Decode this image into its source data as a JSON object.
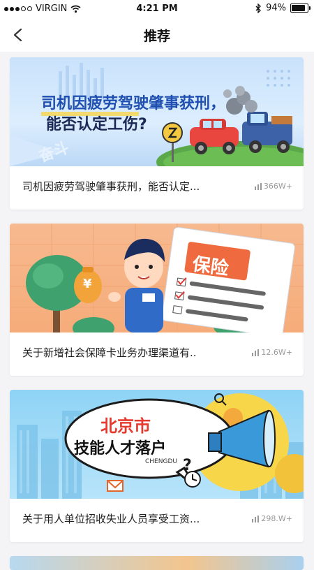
{
  "status": {
    "carrier": "VIRGIN",
    "time": "4:21 PM",
    "battery": "94%"
  },
  "nav": {
    "title": "推荐"
  },
  "cards": [
    {
      "banner_line1": "司机因疲劳驾驶肇事获刑，",
      "banner_line2": "能否认定工伤?",
      "caption": "司机因疲劳驾驶肇事获刑，能否认定...",
      "views": "366W+"
    },
    {
      "banner_sign": "保险",
      "banner_coin": "¥",
      "caption": "关于新增社会保障卡业务办理渠道有..",
      "views": "12.6W+"
    },
    {
      "banner_city": "北京市",
      "banner_line": "技能人才落户",
      "banner_small": "CHENGDU",
      "caption": "关于用人单位招收失业人员享受工资...",
      "views": "298.W+"
    }
  ],
  "colors": {
    "accent": "#1f5fd6",
    "orange": "#ef6b3f",
    "yellow": "#f7d64a"
  }
}
